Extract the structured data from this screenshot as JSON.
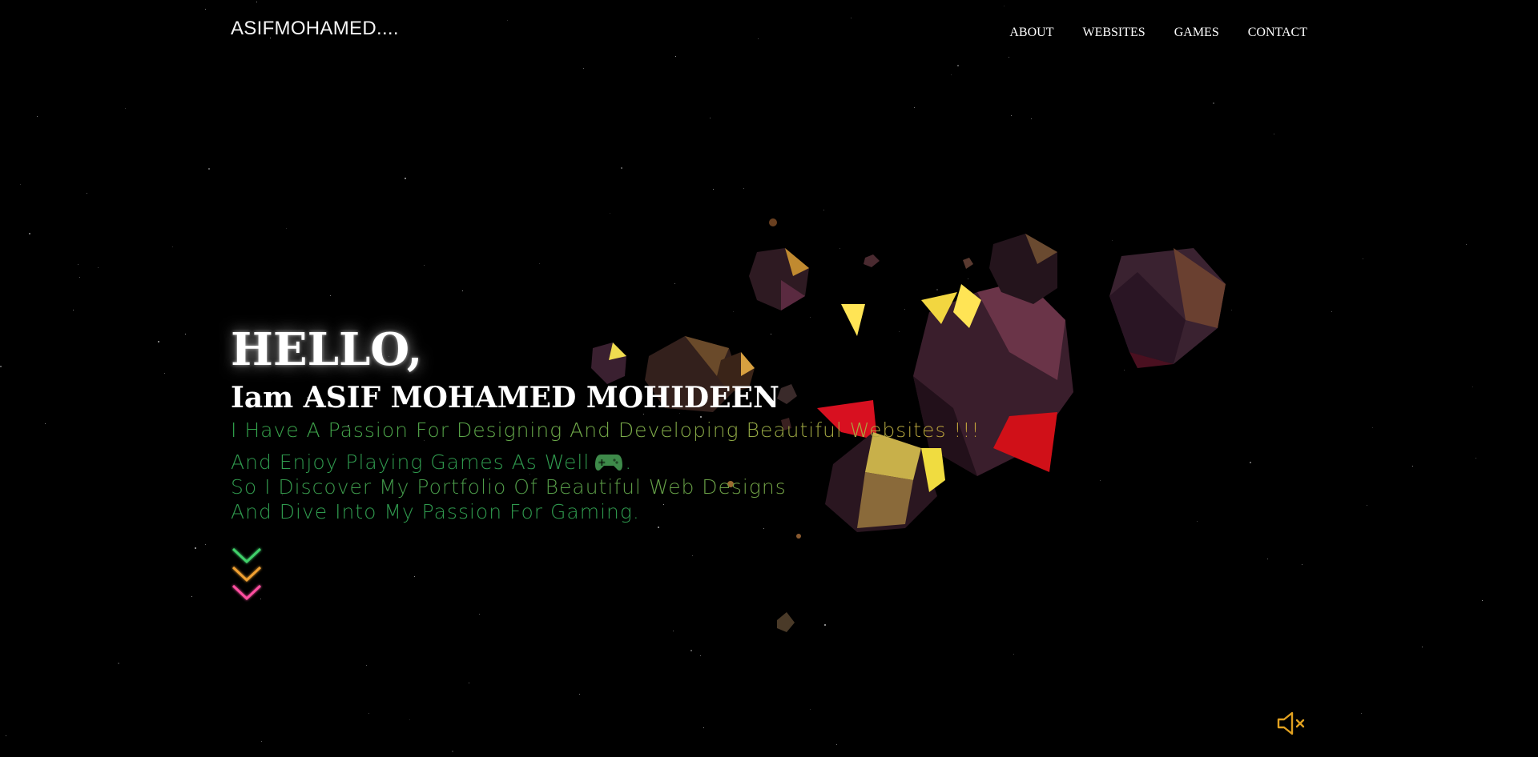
{
  "header": {
    "logo": "ASIFMOHAMED....",
    "nav": [
      "ABOUT",
      "WEBSITES",
      "GAMES",
      "CONTACT"
    ]
  },
  "hero": {
    "greeting": "HELLO,",
    "name": "Iam ASIF MOHAMED MOHIDEEN",
    "line1": "I Have A Passion For Designing And Developing Beautiful Websites !!!",
    "line2": "And Enjoy Playing Games As Well",
    "line2_suffix": ".",
    "line3": "So I Discover My Portfolio Of Beautiful Web Designs",
    "line4": "And Dive Into My Passion For Gaming."
  },
  "icons": {
    "gamepad": "gamepad-icon",
    "scroll_down": "chevrons-down-icon",
    "sound": "speaker-muted-icon"
  },
  "colors": {
    "background": "#000000",
    "text_green": "#2f9a4e",
    "text_gold": "#c3a23a",
    "chevron_green": "#3fd06a",
    "chevron_orange": "#f0a030",
    "chevron_pink": "#ff4fa0",
    "mute_icon": "#e0a020"
  }
}
